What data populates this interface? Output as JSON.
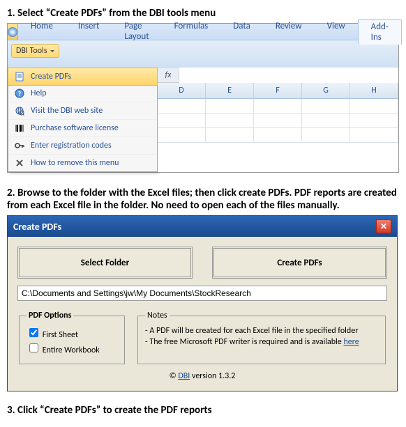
{
  "steps": {
    "s1": "1.  Select “Create PDFs” from the DBI tools menu",
    "s2": "2.  Browse to the folder with the Excel files; then click create PDFs.  PDF reports are created from each Excel file in the folder.  No need to open each of the files manually.",
    "s3": "3. Click “Create PDFs” to create the PDF reports"
  },
  "ribbon": {
    "tabs": [
      "Home",
      "Insert",
      "Page Layout",
      "Formulas",
      "Data",
      "Review",
      "View",
      "Add-Ins"
    ],
    "dbi_button": "DBI Tools"
  },
  "dropdown": {
    "items": [
      "Create PDFs",
      "Help",
      "Visit the DBI web site",
      "Purchase software license",
      "Enter registration codes",
      "How to remove this menu"
    ]
  },
  "sheet": {
    "columns": [
      "D",
      "E",
      "F",
      "G",
      "H"
    ],
    "fx_label": "fx"
  },
  "dialog": {
    "title": "Create PDFs",
    "select_folder": "Select Folder",
    "create_pdfs": "Create PDFs",
    "path": "C:\\Documents and Settings\\jw\\My Documents\\StockResearch",
    "options_legend": "PDF Options",
    "opt1": "First Sheet",
    "opt2": "Entire Workbook",
    "notes_legend": "Notes",
    "note1": "- A PDF will be created for each Excel file in the specified folder",
    "note2": "- The free Microsoft PDF writer is required and is available ",
    "note2_link": "here",
    "footer_prefix": "© ",
    "footer_link": "DBI",
    "footer_suffix": "   version 1.3.2"
  }
}
